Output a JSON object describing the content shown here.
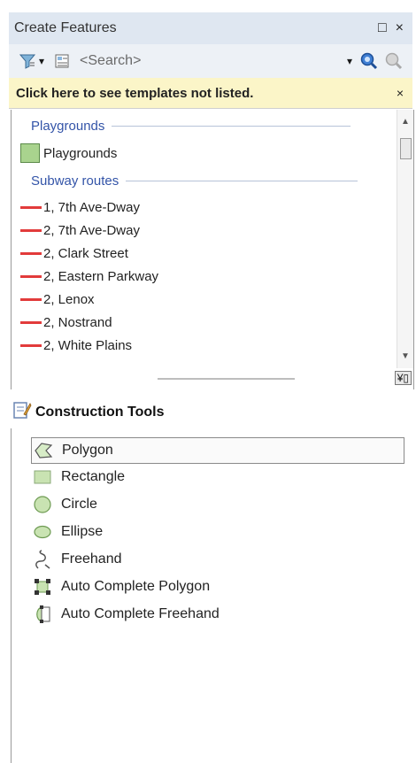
{
  "window": {
    "title": "Create Features",
    "controls": [
      "□",
      "×"
    ]
  },
  "toolbar": {
    "search_placeholder": "<Search>",
    "dropdown_arrow": "▾"
  },
  "infobar": {
    "message": "Click here to see templates not listed.",
    "close": "×"
  },
  "templates": {
    "groups": [
      {
        "header": "Playgrounds",
        "items": [
          {
            "label": "Playgrounds",
            "symbol": "polygon-swatch",
            "color": "#a9d38e"
          }
        ]
      },
      {
        "header": "Subway routes",
        "items": [
          {
            "label": "1, 7th Ave-Dway",
            "symbol": "red-line"
          },
          {
            "label": "2, 7th Ave-Dway",
            "symbol": "red-line"
          },
          {
            "label": "2, Clark Street",
            "symbol": "red-line"
          },
          {
            "label": "2, Eastern Parkway",
            "symbol": "red-line"
          },
          {
            "label": "2, Lenox",
            "symbol": "red-line"
          },
          {
            "label": "2, Nostrand",
            "symbol": "red-line"
          },
          {
            "label": "2, White Plains",
            "symbol": "red-line"
          }
        ]
      }
    ],
    "route_color": "#e23b3b"
  },
  "construction_tools": {
    "header": "Construction Tools",
    "items": [
      {
        "label": "Polygon",
        "icon": "polygon-tool-icon",
        "selected": true
      },
      {
        "label": "Rectangle",
        "icon": "rectangle-tool-icon"
      },
      {
        "label": "Circle",
        "icon": "circle-tool-icon"
      },
      {
        "label": "Ellipse",
        "icon": "ellipse-tool-icon"
      },
      {
        "label": "Freehand",
        "icon": "freehand-tool-icon"
      },
      {
        "label": "Auto Complete Polygon",
        "icon": "auto-complete-polygon-icon"
      },
      {
        "label": "Auto Complete Freehand",
        "icon": "auto-complete-freehand-icon"
      }
    ]
  }
}
